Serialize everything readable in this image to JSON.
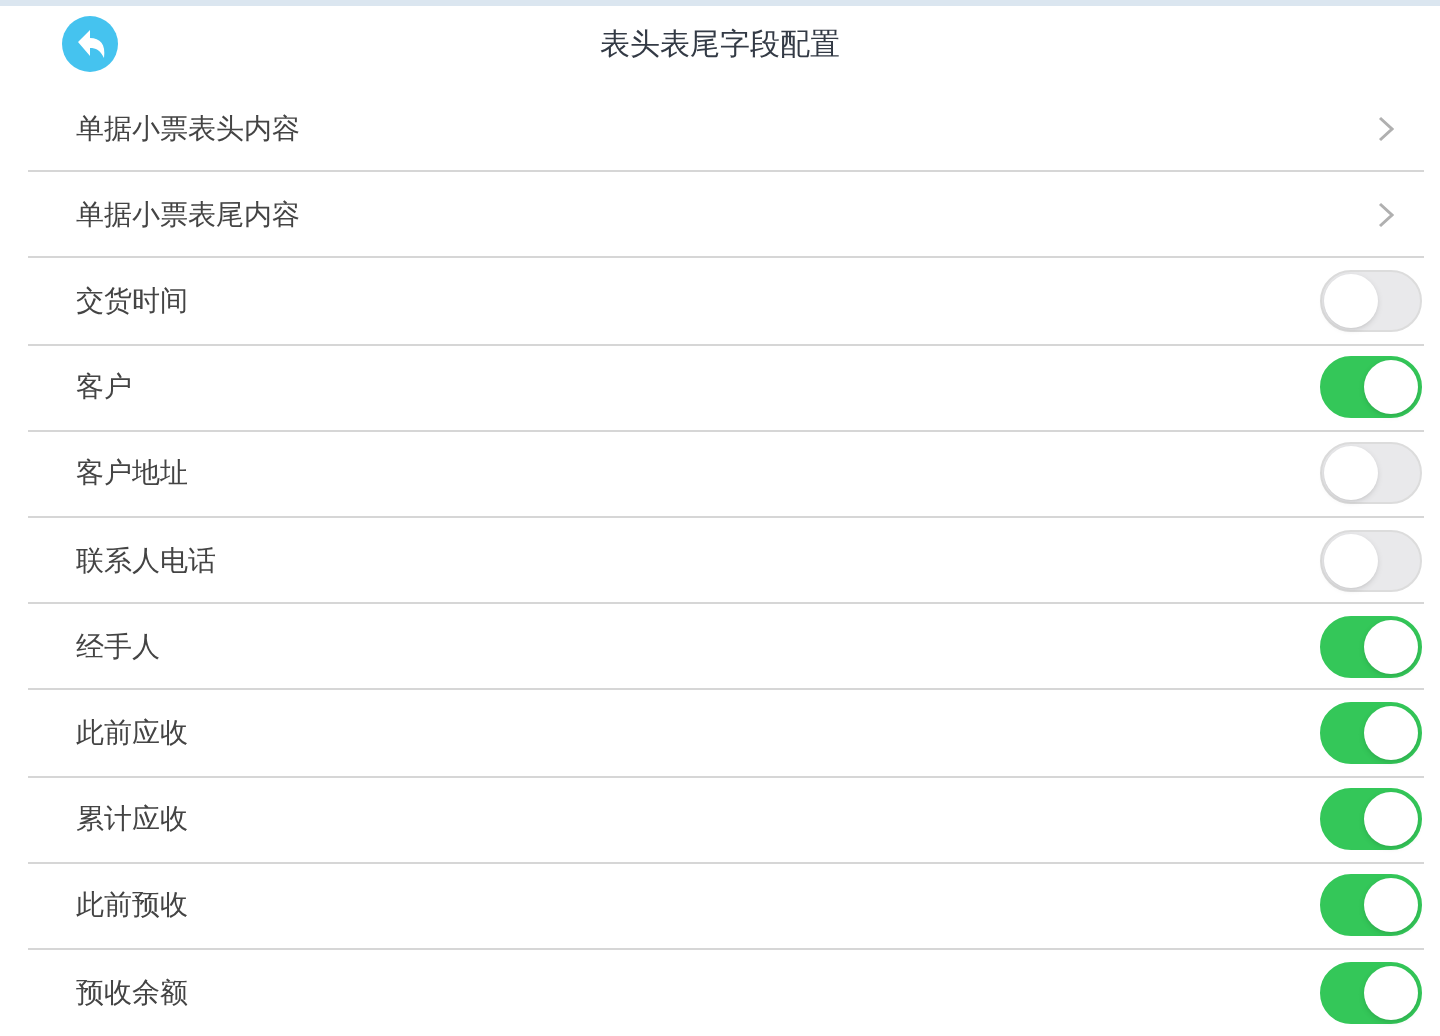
{
  "header": {
    "title": "表头表尾字段配置"
  },
  "rows": [
    {
      "kind": "nav",
      "label": "单据小票表头内容"
    },
    {
      "kind": "nav",
      "label": "单据小票表尾内容"
    },
    {
      "kind": "toggle",
      "label": "交货时间",
      "on": false
    },
    {
      "kind": "toggle",
      "label": "客户",
      "on": true
    },
    {
      "kind": "toggle",
      "label": "客户地址",
      "on": false
    },
    {
      "kind": "toggle",
      "label": "联系人电话",
      "on": false
    },
    {
      "kind": "toggle",
      "label": "经手人",
      "on": true
    },
    {
      "kind": "toggle",
      "label": "此前应收",
      "on": true
    },
    {
      "kind": "toggle",
      "label": "累计应收",
      "on": true
    },
    {
      "kind": "toggle",
      "label": "此前预收",
      "on": true
    },
    {
      "kind": "toggle",
      "label": "预收余额",
      "on": true
    }
  ]
}
